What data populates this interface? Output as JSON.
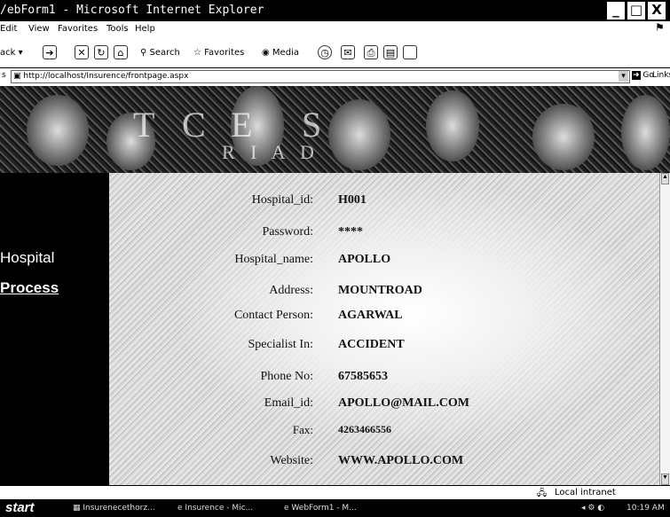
{
  "window": {
    "title": "/ebForm1 - Microsoft Internet Explorer",
    "minimize_label": "_",
    "maximize_label": "□",
    "close_label": "X"
  },
  "menu": [
    "Edit",
    "View",
    "Favorites",
    "Tools",
    "Help"
  ],
  "toolbar": {
    "back_label": "ack",
    "search_label": "Search",
    "favorites_label": "Favorites",
    "media_label": "Media"
  },
  "address": {
    "label": "s",
    "url": "http://localhost/Insurence/frontpage.aspx",
    "go_label": "Go",
    "links_label": "Links"
  },
  "banner": {
    "letters_top": [
      "T",
      "C",
      "E",
      "S"
    ],
    "letters_bottom": "R I A   D"
  },
  "sidebar": {
    "items": [
      "Hospital",
      "Process"
    ]
  },
  "form": {
    "fields": [
      {
        "label": "Hospital_id:",
        "value": "H001"
      },
      {
        "label": "Password:",
        "value": "****"
      },
      {
        "label": "Hospital_name:",
        "value": "APOLLO"
      },
      {
        "label": "Address:",
        "value": "MOUNTROAD"
      },
      {
        "label": "Contact Person:",
        "value": "AGARWAL"
      },
      {
        "label": "Specialist In:",
        "value": "ACCIDENT"
      },
      {
        "label": "Phone No:",
        "value": "67585653"
      },
      {
        "label": "Email_id:",
        "value": "APOLLO@MAIL.COM"
      },
      {
        "label": "Fax:",
        "value": "4263466556"
      },
      {
        "label": "Website:",
        "value": "WWW.APOLLO.COM"
      }
    ]
  },
  "status": {
    "zone": "Local intranet"
  },
  "taskbar": {
    "start_label": "start",
    "tasks": [
      "Insurenecethorz...",
      "Insurence - Mic...",
      "WebForm1 - M..."
    ],
    "clock": "10:19 AM"
  }
}
